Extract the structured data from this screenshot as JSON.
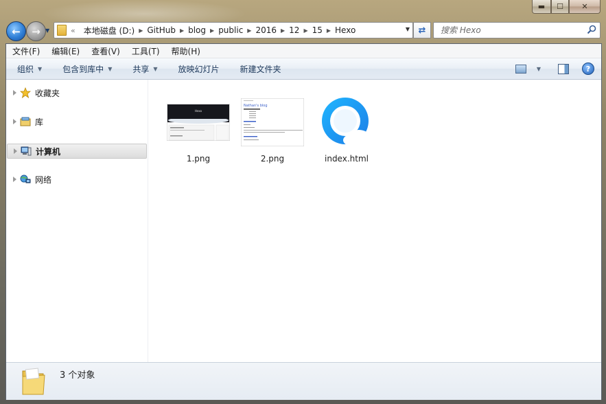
{
  "window": {
    "min_glyph": "▬",
    "max_glyph": "☐",
    "close_glyph": "✕"
  },
  "nav": {
    "back_glyph": "←",
    "forward_glyph": "→"
  },
  "address": {
    "crumbs": [
      "本地磁盘 (D:)",
      "GitHub",
      "blog",
      "public",
      "2016",
      "12",
      "15",
      "Hexo"
    ],
    "overflow": "«"
  },
  "search": {
    "placeholder": "搜索 Hexo"
  },
  "menubar": {
    "items": [
      "文件(F)",
      "编辑(E)",
      "查看(V)",
      "工具(T)",
      "帮助(H)"
    ]
  },
  "toolbar": {
    "organize": "组织",
    "include_library": "包含到库中",
    "share": "共享",
    "slideshow": "放映幻灯片",
    "new_folder": "新建文件夹",
    "help_glyph": "?"
  },
  "sidebar": {
    "items": [
      {
        "label": "收藏夹",
        "icon": "star-icon"
      },
      {
        "label": "库",
        "icon": "library-icon"
      },
      {
        "label": "计算机",
        "icon": "computer-icon",
        "selected": true
      },
      {
        "label": "网络",
        "icon": "network-icon"
      }
    ]
  },
  "files": [
    {
      "name": "1.png",
      "icon": "image-thumbnail",
      "thumb_text": "Hexo"
    },
    {
      "name": "2.png",
      "icon": "image-thumbnail",
      "thumb_text": "Nathan's blog"
    },
    {
      "name": "index.html",
      "icon": "qq-browser-icon"
    }
  ],
  "status": {
    "text": "3 个对象"
  },
  "colors": {
    "accent": "#2f7fd6",
    "toolbar_text": "#1e395b",
    "selection": "#dcdcdc"
  }
}
